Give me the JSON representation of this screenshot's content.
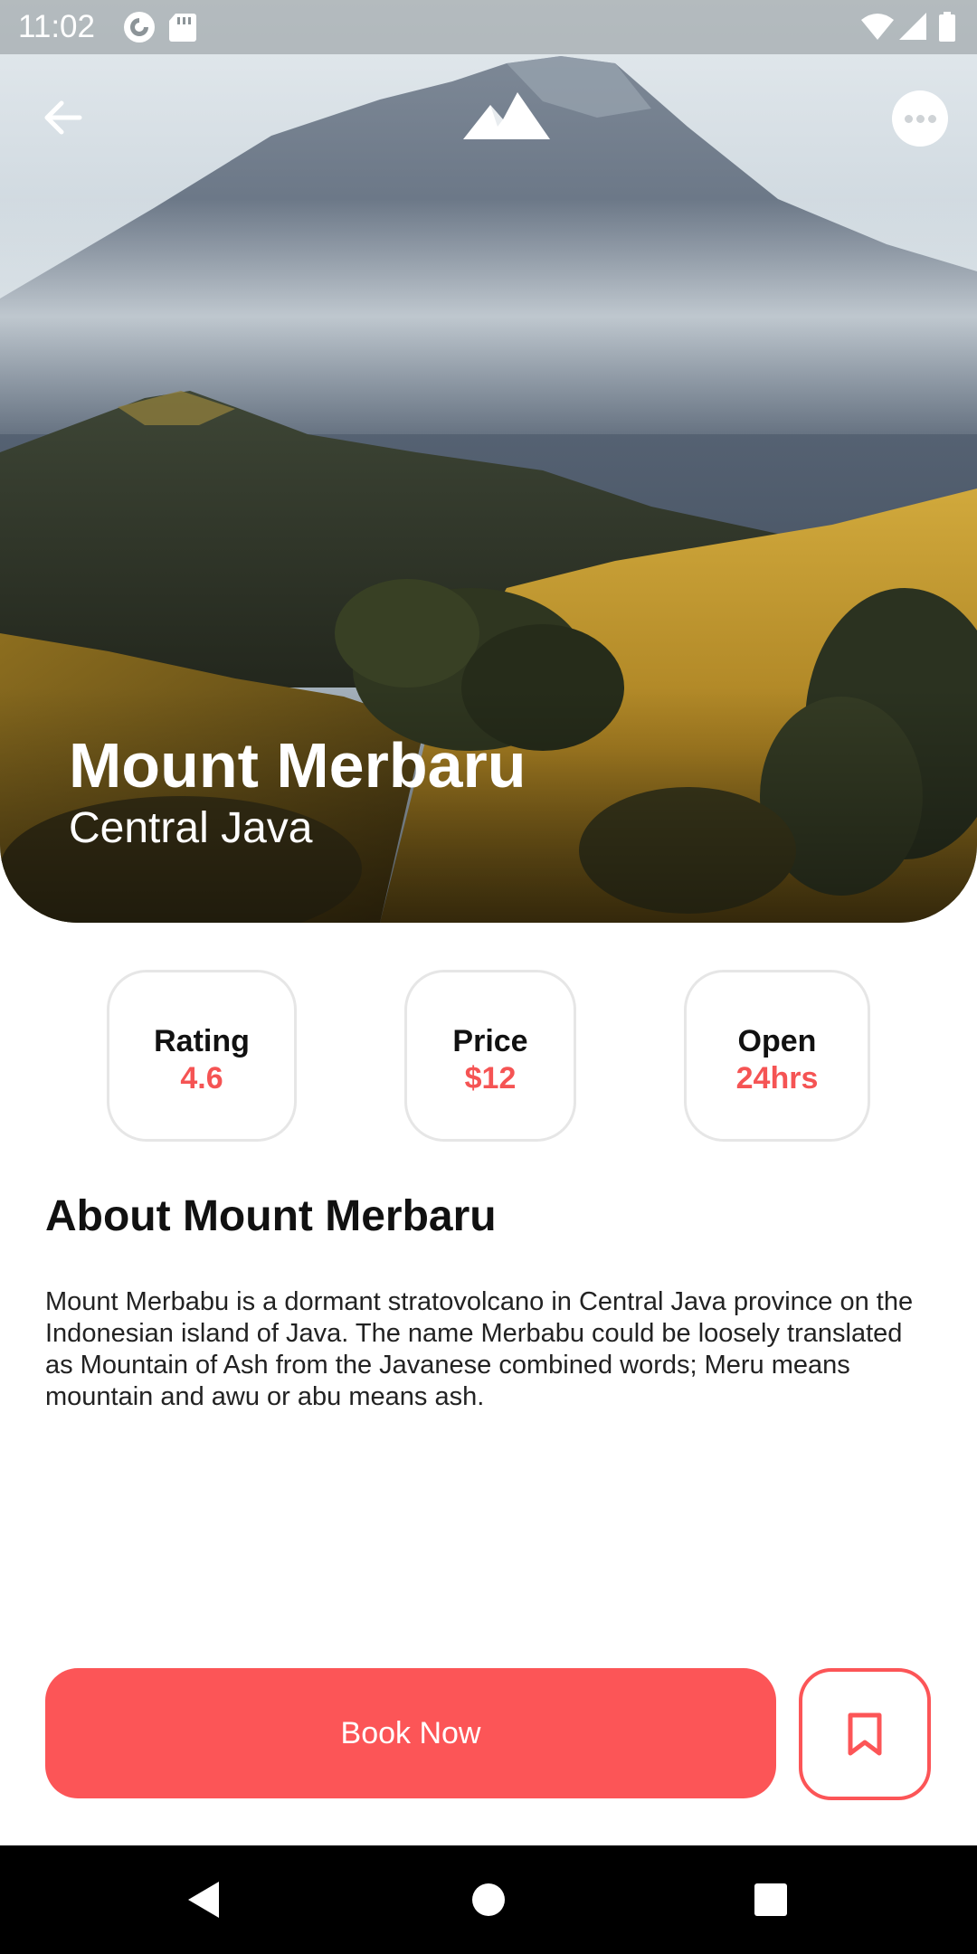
{
  "status_bar": {
    "time": "11:02",
    "icons": [
      "pocket-casts-icon",
      "sd-card-icon",
      "wifi-icon",
      "cell-signal-icon",
      "battery-icon"
    ]
  },
  "app_bar": {
    "icons": [
      "arrow-back-icon",
      "mountain-logo-icon",
      "more-horizontal-icon"
    ]
  },
  "hero": {
    "title": "Mount Merbaru",
    "subtitle": "Central Java"
  },
  "stats": [
    {
      "label": "Rating",
      "value": "4.6"
    },
    {
      "label": "Price",
      "value": "$12"
    },
    {
      "label": "Open",
      "value": "24hrs"
    }
  ],
  "about": {
    "heading": "About Mount Merbaru",
    "body": "Mount Merbabu is a dormant stratovolcano in Central Java province on the Indonesian island of Java. The name Merbabu could be loosely translated as Mountain of Ash from the Javanese combined words; Meru means mountain and awu or abu means ash."
  },
  "actions": {
    "book_label": "Book Now",
    "bookmark_icon": "bookmark-icon"
  },
  "nav_bar": {
    "icons": [
      "nav-back-icon",
      "nav-home-icon",
      "nav-recents-icon"
    ]
  },
  "colors": {
    "accent": "#fc5557",
    "stat_value": "#f55454",
    "card_border": "#e6e6e6",
    "text_primary": "#111111",
    "nav_bar": "#000000"
  }
}
